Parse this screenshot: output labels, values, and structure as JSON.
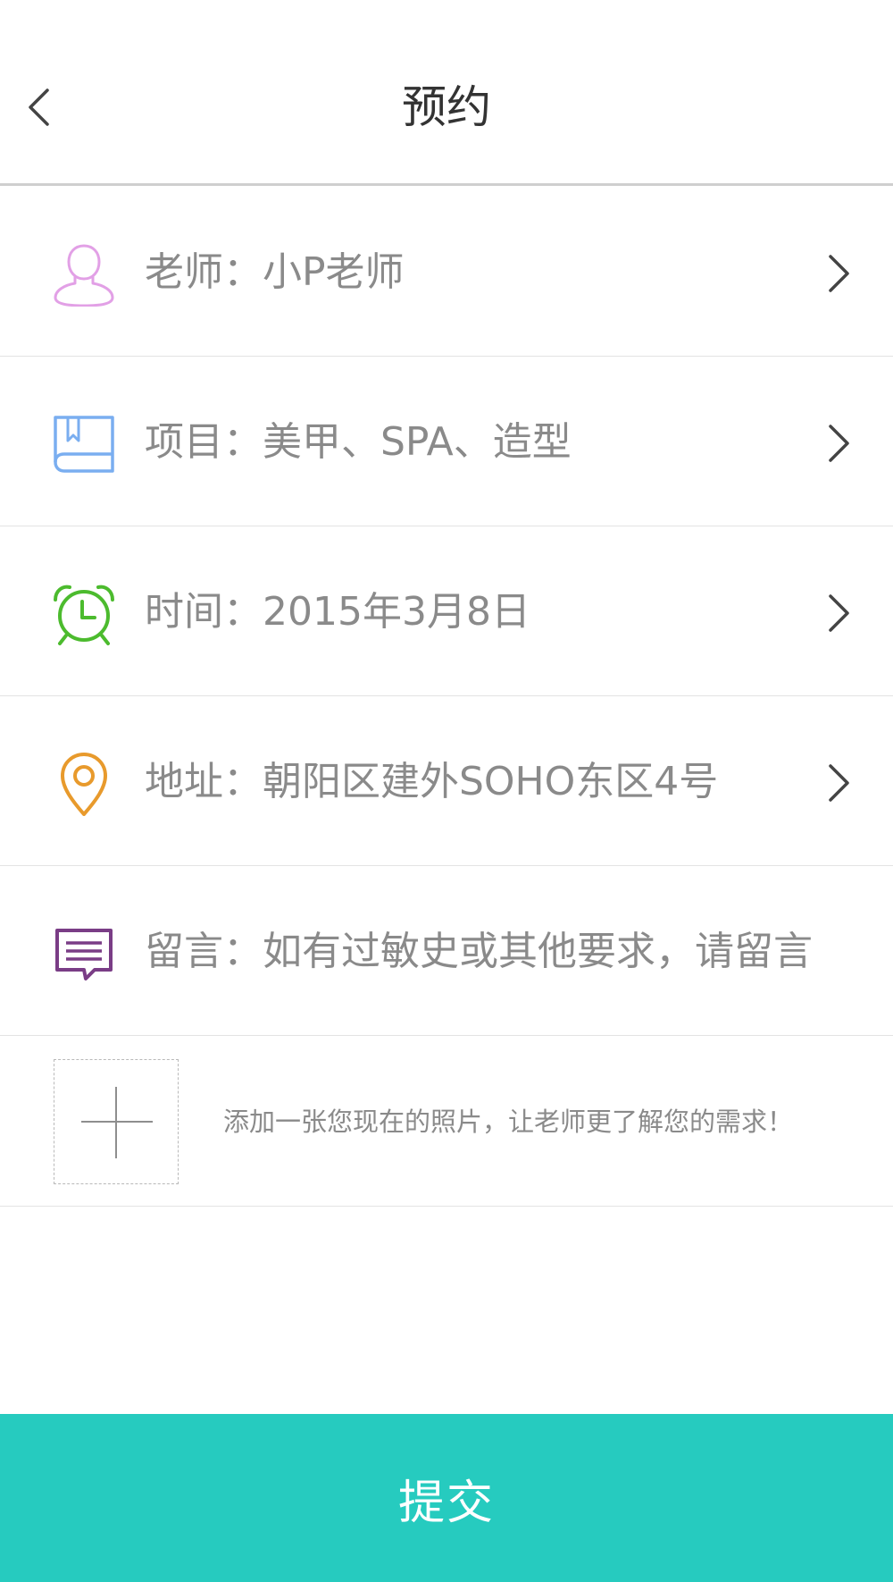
{
  "header": {
    "title": "预约",
    "back_icon": "chevron-left-icon"
  },
  "rows": [
    {
      "key": "teacher",
      "text": "老师：小P老师",
      "icon": "user-icon",
      "color": "#e2a0e6"
    },
    {
      "key": "project",
      "text": "项目：美甲、SPA、造型",
      "icon": "book-icon",
      "color": "#7aaef0"
    },
    {
      "key": "time",
      "text": "时间：2015年3月8日",
      "icon": "alarm-clock-icon",
      "color": "#4cbb2e"
    },
    {
      "key": "address",
      "text": "地址：朝阳区建外SOHO东区4号",
      "icon": "location-pin-icon",
      "color": "#e89a2c"
    },
    {
      "key": "message",
      "text": "留言：如有过敏史或其他要求，请留言",
      "icon": "message-icon",
      "color": "#7a3d86"
    }
  ],
  "photo": {
    "icon": "plus-icon",
    "hint": "添加一张您现在的照片，让老师更了解您的需求！"
  },
  "submit": {
    "label": "提交",
    "color": "#26cbbf"
  },
  "chevron_icon": "chevron-right-icon"
}
